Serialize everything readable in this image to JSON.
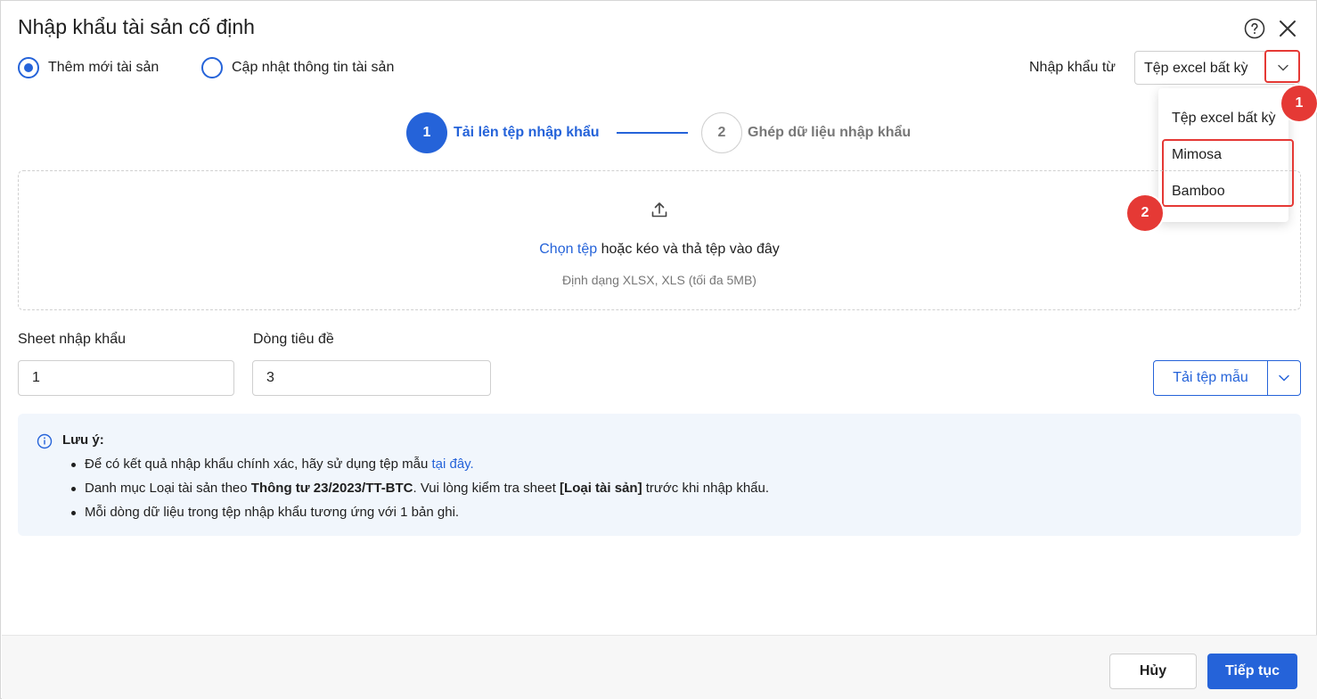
{
  "dialog": {
    "title": "Nhập khẩu tài sản cố định"
  },
  "mode": {
    "options": [
      {
        "label": "Thêm mới tài sản",
        "checked": true
      },
      {
        "label": "Cập nhật thông tin tài sản",
        "checked": false
      }
    ]
  },
  "import_source": {
    "label": "Nhập khẩu từ",
    "selected": "Tệp excel bất kỳ",
    "options": [
      "Tệp excel bất kỳ",
      "Mimosa",
      "Bamboo"
    ]
  },
  "annotations": {
    "badge_1": "1",
    "badge_2": "2",
    "highlight_color": "#e53935"
  },
  "steps": [
    {
      "number": "1",
      "label": "Tải lên tệp nhập khẩu",
      "active": true
    },
    {
      "number": "2",
      "label": "Ghép dữ liệu nhập khẩu",
      "active": false
    }
  ],
  "upload": {
    "choose_link": "Chọn tệp",
    "text_rest": " hoặc kéo và thả tệp vào đây",
    "hint": "Định dạng XLSX, XLS (tối đa 5MB)"
  },
  "fields": {
    "sheet_label": "Sheet nhập khẩu",
    "sheet_value": "1",
    "header_row_label": "Dòng tiêu đề",
    "header_row_value": "3"
  },
  "template_button": {
    "label": "Tải tệp mẫu"
  },
  "note": {
    "title": "Lưu ý:",
    "item1_text": "Để có kết quả nhập khẩu chính xác, hãy sử dụng tệp mẫu ",
    "item1_link": "tại đây.",
    "item2_a": "Danh mục Loại tài sản theo ",
    "item2_b": "Thông tư 23/2023/TT-BTC",
    "item2_c": ". Vui lòng kiểm tra sheet ",
    "item2_d": "[Loại tài sản]",
    "item2_e": " trước khi nhập khẩu.",
    "item3_text": "Mỗi dòng dữ liệu trong tệp nhập khẩu tương ứng với 1 bản ghi."
  },
  "footer": {
    "cancel_label": "Hủy",
    "continue_label": "Tiếp tục"
  },
  "colors": {
    "primary": "#2563d9",
    "note_bg": "#f1f6fc"
  },
  "icons": [
    "help-icon",
    "close-icon",
    "chevron-down-icon",
    "upload-icon",
    "info-icon"
  ]
}
